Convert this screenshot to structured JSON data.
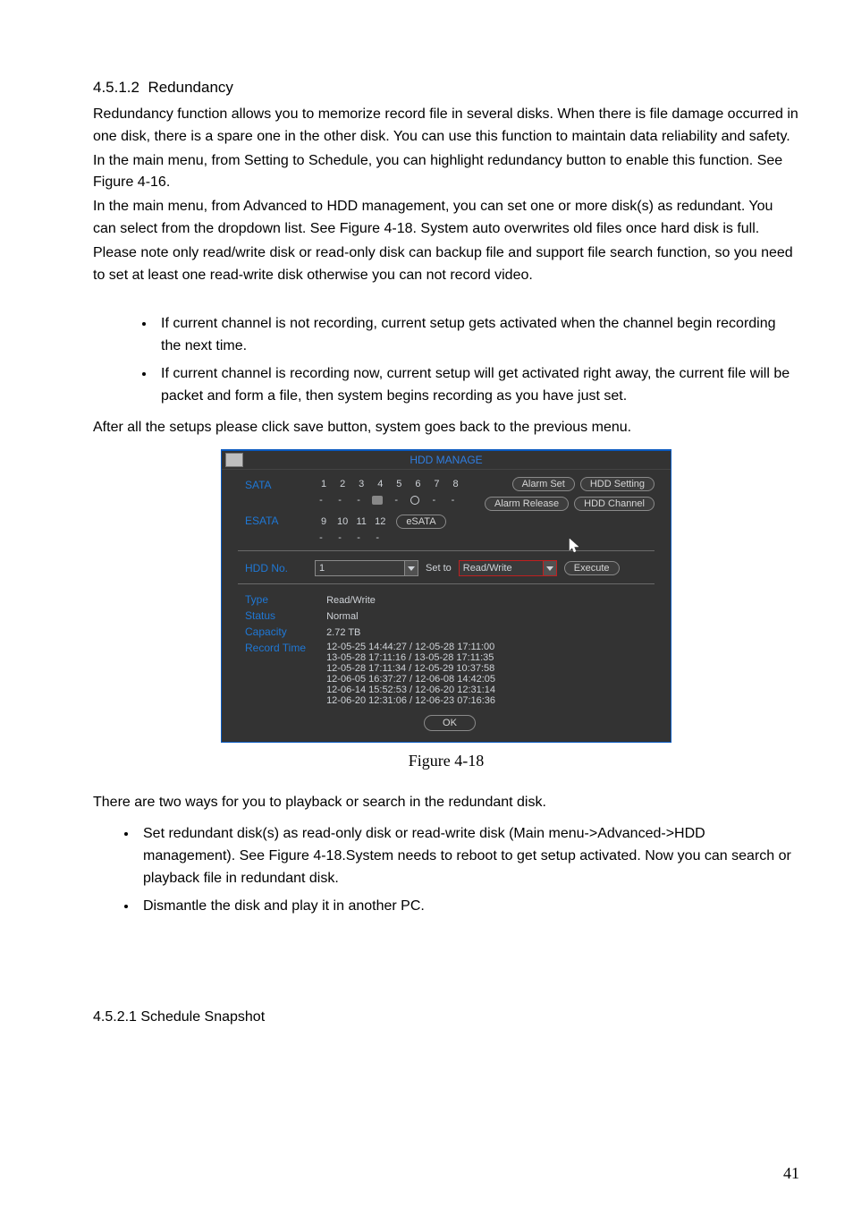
{
  "section": {
    "number": "4.5.1.2",
    "title": "Redundancy",
    "p1": "Redundancy function allows you to memorize record file in several disks. When there is file damage occurred in one disk, there is a spare one in the other disk. You can use this function to maintain data reliability and safety.",
    "p2": "In the main menu, from Setting to Schedule, you can highlight redundancy button to enable this function. See Figure 4-16.",
    "p3": "In the main menu, from Advanced to HDD management, you can set one or more disk(s) as redundant. You can select from the dropdown list. See Figure 4-18. System auto overwrites old files once hard disk is full.",
    "p4": "Please note only read/write disk or read-only disk can backup file and support file search function, so you need to set at least one read-write disk otherwise you can not record video.",
    "bul1": "If current channel is not recording, current setup gets activated when the channel begin recording the next time.",
    "bul2": "If current channel is recording now, current setup will get activated right away, the current file will be packet and form a file, then system begins recording as you have just set.",
    "p5": "After all the setups please click save button, system goes back to the previous menu."
  },
  "hdd": {
    "title": "HDD MANAGE",
    "sata_label": "SATA",
    "sata_nums": [
      "1",
      "2",
      "3",
      "4",
      "5",
      "6",
      "7",
      "8"
    ],
    "esata_label": "ESATA",
    "esata_nums": [
      "9",
      "10",
      "11",
      "12"
    ],
    "esata_chip": "eSATA",
    "btn_alarm_set": "Alarm Set",
    "btn_hdd_setting": "HDD Setting",
    "btn_alarm_release": "Alarm Release",
    "btn_hdd_channel": "HDD Channel",
    "hdd_no_label": "HDD No.",
    "hdd_no_value": "1",
    "set_to_label": "Set to",
    "set_to_value": "Read/Write",
    "execute_btn": "Execute",
    "info": {
      "type_k": "Type",
      "type_v": "Read/Write",
      "status_k": "Status",
      "status_v": "Normal",
      "capacity_k": "Capacity",
      "capacity_v": "2.72 TB",
      "recordtime_k": "Record Time",
      "recordtime_v": [
        "12-05-25 14:44:27 / 12-05-28 17:11:00",
        "13-05-28 17:11:16 / 13-05-28 17:11:35",
        "12-05-28 17:11:34 / 12-05-29 10:37:58",
        "12-06-05 16:37:27 / 12-06-08 14:42:05",
        "12-06-14 15:52:53 / 12-06-20 12:31:14",
        "12-06-20 12:31:06 / 12-06-23 07:16:36"
      ]
    },
    "ok_btn": "OK"
  },
  "figure_caption": "Figure 4-18",
  "post": {
    "p1": "There are two ways for you to playback or search in the redundant disk.",
    "bul1": "Set redundant disk(s) as read-only disk or read-write disk (Main menu->Advanced->HDD management).  See Figure 4-18.System needs to reboot to get setup activated. Now you can search or playback file in redundant disk.",
    "bul2": "Dismantle the disk and play it in another PC."
  },
  "next_heading": "4.5.2.1 Schedule Snapshot",
  "page_number": "41"
}
